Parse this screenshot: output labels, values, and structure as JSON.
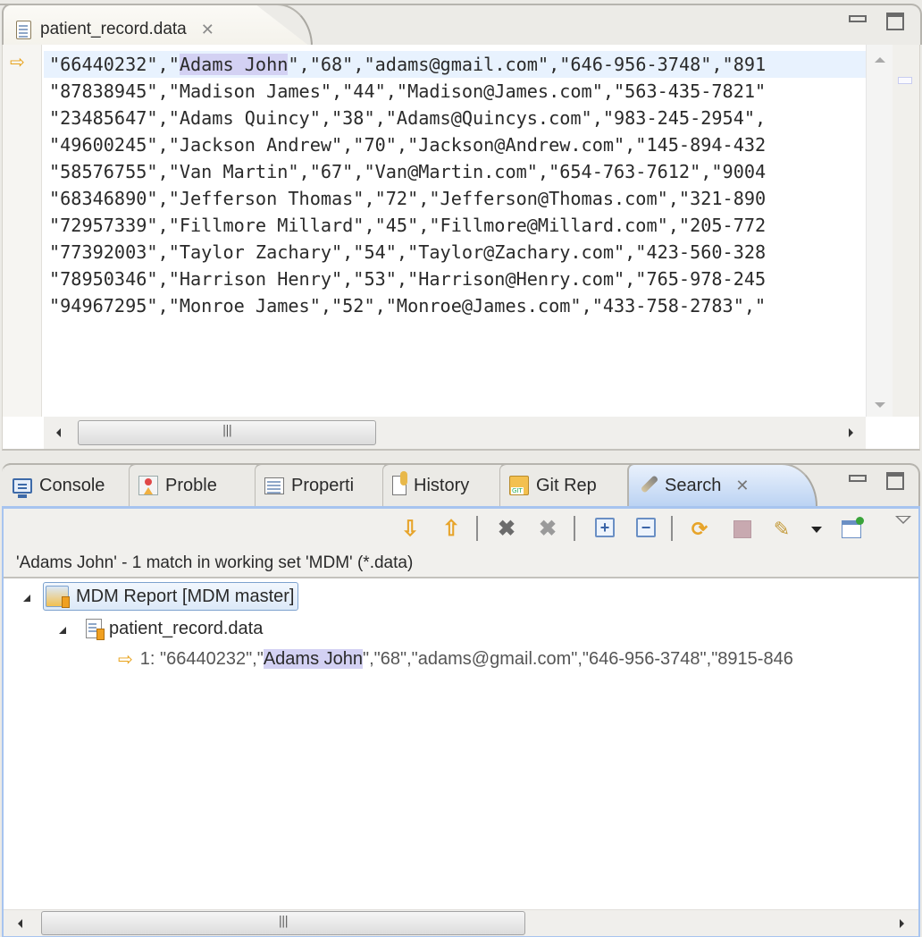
{
  "editor": {
    "tab_title": "patient_record.data",
    "tab_icon": "text-file-icon",
    "close_icon": "close-x-icon",
    "current_line_marker": "arrow-right-icon",
    "lines": [
      {
        "pre": "\"66440232\",\"",
        "hl": "Adams John",
        "post": "\",\"68\",\"adams@gmail.com\",\"646-956-3748\",\"891"
      },
      {
        "pre": "\"87838945\",\"Madison James\",\"44\",\"Madison@James.com\",\"563-435-7821\""
      },
      {
        "pre": "\"23485647\",\"Adams Quincy\",\"38\",\"Adams@Quincys.com\",\"983-245-2954\","
      },
      {
        "pre": "\"49600245\",\"Jackson Andrew\",\"70\",\"Jackson@Andrew.com\",\"145-894-432"
      },
      {
        "pre": "\"58576755\",\"Van Martin\",\"67\",\"Van@Martin.com\",\"654-763-7612\",\"9004"
      },
      {
        "pre": "\"68346890\",\"Jefferson Thomas\",\"72\",\"Jefferson@Thomas.com\",\"321-890"
      },
      {
        "pre": "\"72957339\",\"Fillmore Millard\",\"45\",\"Fillmore@Millard.com\",\"205-772"
      },
      {
        "pre": "\"77392003\",\"Taylor Zachary\",\"54\",\"Taylor@Zachary.com\",\"423-560-328"
      },
      {
        "pre": "\"78950346\",\"Harrison Henry\",\"53\",\"Harrison@Henry.com\",\"765-978-245"
      },
      {
        "pre": "\"94967295\",\"Monroe James\",\"52\",\"Monroe@James.com\",\"433-758-2783\",\""
      }
    ],
    "hscroll_position": 0.0,
    "hscroll_visible_fraction": 0.39
  },
  "view_tabs": [
    {
      "label": "Console",
      "icon": "console-icon",
      "active": false
    },
    {
      "label": "Proble",
      "icon": "problems-icon",
      "active": false
    },
    {
      "label": "Properti",
      "icon": "properties-icon",
      "active": false
    },
    {
      "label": "History",
      "icon": "history-icon",
      "active": false
    },
    {
      "label": "Git Rep",
      "icon": "git-repositories-icon",
      "active": false
    },
    {
      "label": "Search",
      "icon": "search-icon",
      "active": true
    }
  ],
  "search_toolbar": {
    "next_match": "Show Next Match",
    "previous_match": "Show Previous Match",
    "remove_selected": "Remove Selected Matches",
    "remove_all": "Remove All Matches",
    "expand_all": "Expand All",
    "collapse_all": "Collapse All",
    "run_again": "Run the Current Search Again",
    "cancel": "Cancel Current Search",
    "history": "Show Previous Searches",
    "pin": "Pin the Search View"
  },
  "search": {
    "summary": "'Adams John' - 1 match in working set 'MDM' (*.data)",
    "project": "MDM Report  [MDM master]",
    "file": "patient_record.data",
    "match": {
      "prefix": "1: \"66440232\",\"",
      "hl": "Adams John",
      "post": "\",\"68\",\"adams@gmail.com\",\"646-956-3748\",\"8915-846"
    },
    "hscroll_position": 0.0,
    "hscroll_visible_fraction": 0.57
  }
}
